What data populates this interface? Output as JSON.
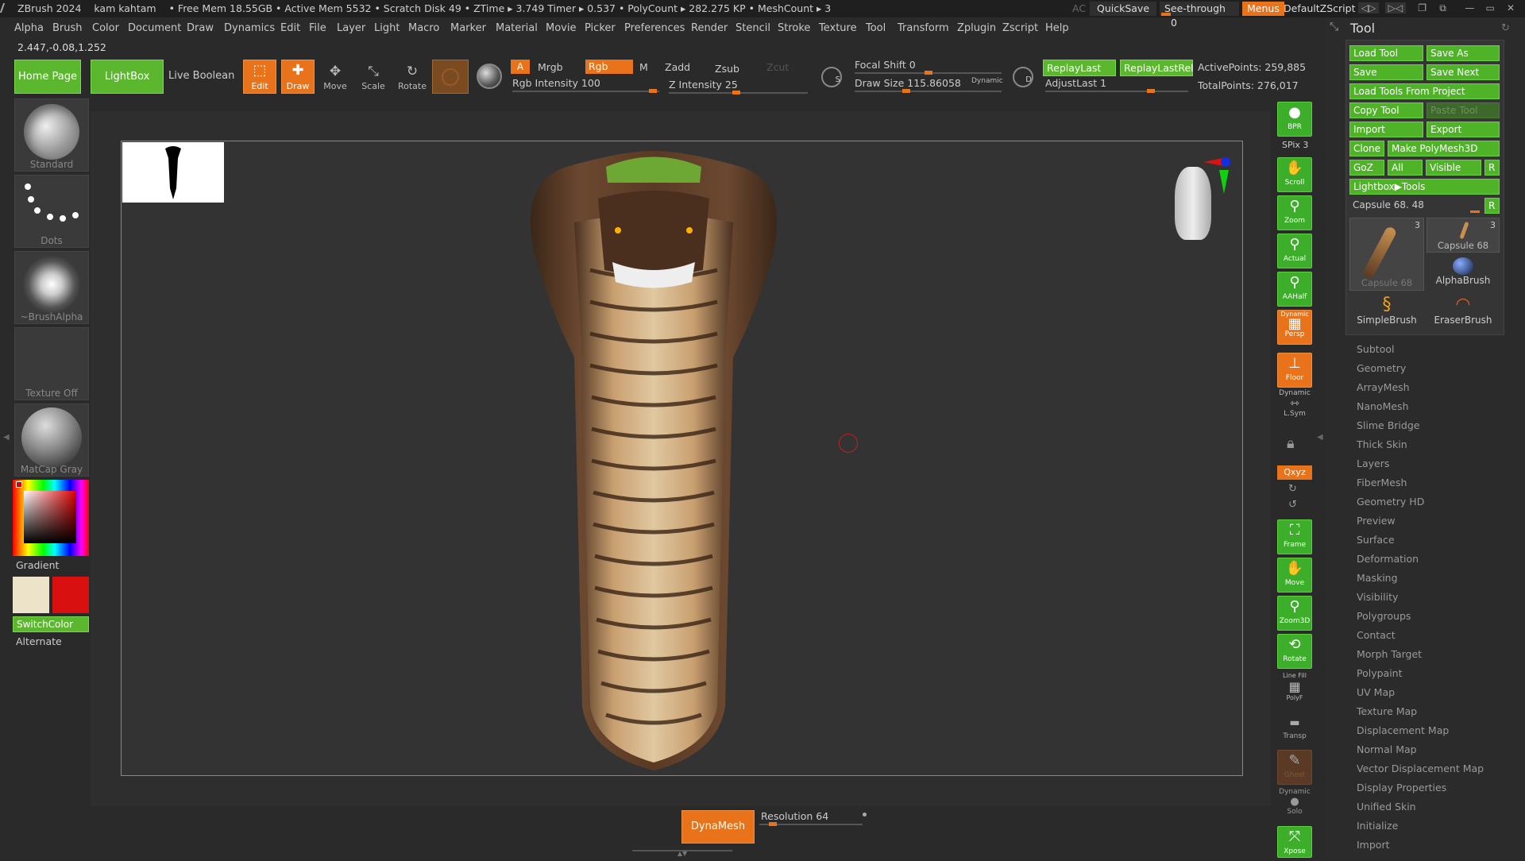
{
  "titlebar": {
    "app": "ZBrush 2024",
    "user": "kam kahtam",
    "stats": "• Free Mem 18.55GB • Active Mem 5532 • Scratch Disk 49 • ZTime ▸ 3.749 Timer ▸ 0.537 • PolyCount ▸ 282.275 KP • MeshCount ▸ 3",
    "ac": "AC",
    "quicksave": "QuickSave",
    "seethrough": "See-through",
    "seethrough_value": "0",
    "menus": "Menus",
    "script": "DefaultZScript"
  },
  "menu": [
    "Alpha",
    "Brush",
    "Color",
    "Document",
    "Draw",
    "Dynamics",
    "Edit",
    "File",
    "Layer",
    "Light",
    "Macro",
    "Marker",
    "Material",
    "Movie",
    "Picker",
    "Preferences",
    "Render",
    "Stencil",
    "Stroke",
    "Texture",
    "Tool",
    "Transform",
    "Zplugin",
    "Zscript",
    "Help"
  ],
  "coords": "2.447,-0.08,1.252",
  "toolbar": {
    "home": "Home Page",
    "lightbox": "LightBox",
    "liveboolean": "Live Boolean",
    "edit": "Edit",
    "draw": "Draw",
    "move": "Move",
    "scale": "Scale",
    "rotate": "Rotate",
    "a": "A",
    "mrgb": "Mrgb",
    "rgb": "Rgb",
    "m": "M",
    "zadd": "Zadd",
    "zsub": "Zsub",
    "zcut": "Zcut",
    "rgb_intensity": "Rgb Intensity 100",
    "z_intensity": "Z Intensity 25",
    "focal_shift": "Focal Shift 0",
    "draw_size": "Draw Size 115.86058",
    "dynamic": "Dynamic",
    "replaylast": "ReplayLast",
    "replaylastrel": "ReplayLastRel",
    "adjustlast": "AdjustLast 1",
    "activepoints": "ActivePoints: 259,885",
    "totalpoints": "TotalPoints: 276,017"
  },
  "left": {
    "standard": "Standard",
    "dots": "Dots",
    "brushalpha": "~BrushAlpha",
    "texture": "Texture Off",
    "matcap": "MatCap Gray",
    "gradient": "Gradient",
    "switchcolor": "SwitchColor",
    "alternate": "Alternate"
  },
  "right_strip": {
    "bpr": "BPR",
    "spix": "SPix 3",
    "scroll": "Scroll",
    "zoom": "Zoom",
    "actual": "Actual",
    "aahalf": "AAHalf",
    "dynamic_persp": "Dynamic",
    "persp": "Persp",
    "floor": "Floor",
    "lsym_dyn": "Dynamic",
    "lsym": "L.Sym",
    "xyz": "Qxyz",
    "frame": "Frame",
    "move": "Move",
    "zoom3d": "Zoom3D",
    "rotate": "Rotate",
    "linefill": "Line Fill",
    "polyf": "PolyF",
    "transp": "Transp",
    "ghost": "Ghost",
    "solo_dyn": "Dynamic",
    "solo": "Solo",
    "xpose": "Xpose"
  },
  "tool": {
    "title": "Tool",
    "load_tool": "Load Tool",
    "save_as": "Save As",
    "save": "Save",
    "save_next": "Save Next",
    "load_from_project": "Load Tools From Project",
    "copy_tool": "Copy Tool",
    "paste_tool": "Paste Tool",
    "import": "Import",
    "export": "Export",
    "clone": "Clone",
    "make_polymesh": "Make PolyMesh3D",
    "goz": "GoZ",
    "all": "All",
    "visible": "Visible",
    "r": "R",
    "lightbox_tools": "Lightbox▶Tools",
    "capsule_slider": "Capsule 68. 48",
    "thumb1": "Capsule 68",
    "thumb1_count": "3",
    "thumb2": "Capsule 68",
    "thumb2_count": "3",
    "alphabrush": "AlphaBrush",
    "simplebrush": "SimpleBrush",
    "eraserbrush": "EraserBrush",
    "sections": [
      "Subtool",
      "Geometry",
      "ArrayMesh",
      "NanoMesh",
      "Slime Bridge",
      "Thick Skin",
      "Layers",
      "FiberMesh",
      "Geometry HD",
      "Preview",
      "Surface",
      "Deformation",
      "Masking",
      "Visibility",
      "Polygroups",
      "Contact",
      "Morph Target",
      "Polypaint",
      "UV Map",
      "Texture Map",
      "Displacement Map",
      "Normal Map",
      "Vector Displacement Map",
      "Display Properties",
      "Unified Skin",
      "Initialize",
      "Import"
    ]
  },
  "bottom": {
    "dynamesh": "DynaMesh",
    "resolution": "Resolution 64"
  },
  "colors": {
    "green": "#5bb82e",
    "orange": "#e8731a"
  }
}
